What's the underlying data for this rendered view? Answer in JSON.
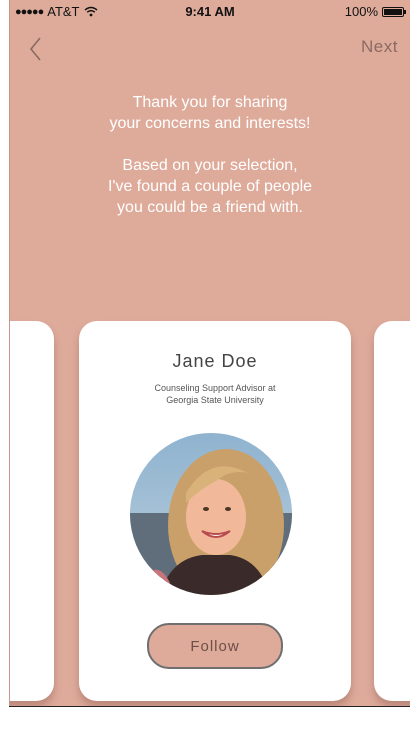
{
  "status_bar": {
    "carrier": "AT&T",
    "time": "9:41 AM",
    "battery": "100%",
    "battery_level": 1.0,
    "icons": [
      "signal-dots-icon",
      "wifi-icon",
      "battery-icon"
    ]
  },
  "nav": {
    "back_icon": "chevron-left-icon",
    "next_label": "Next"
  },
  "message": {
    "line1": "Thank you for sharing",
    "line2": "your concerns and interests!",
    "line3": "Based on your selection,",
    "line4": "I've found a couple of people",
    "line5": "you could be a friend with."
  },
  "profile_card": {
    "name": "Jane Doe",
    "role_line1": "Counseling Support Advisor at",
    "role_line2": "Georgia State University",
    "avatar_icon": "profile-photo",
    "follow_label": "Follow"
  },
  "colors": {
    "background": "#deab9b",
    "card": "#ffffff",
    "text_light": "#ffffff",
    "accent_text": "#8a6a63"
  }
}
